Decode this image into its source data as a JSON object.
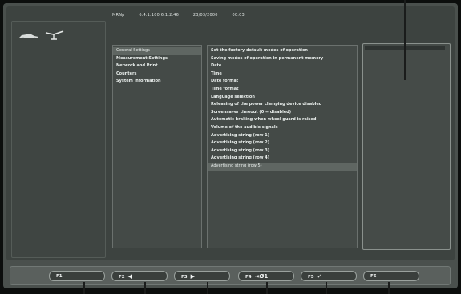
{
  "status": {
    "left": "MRNp",
    "versions": "6.4.1.100  6.1.2.46",
    "date": "23/03/2000",
    "time": "00:03"
  },
  "menu": {
    "items": [
      "General Settings",
      "Measurement Settings",
      "Network and Print",
      "Counters",
      "System information"
    ],
    "selected_index": 0
  },
  "options": {
    "items": [
      "Set the factory default modes of operation",
      "Saving modes of operation in permanent memory",
      "Date",
      "Time",
      "Date format",
      "Time format",
      "Language selection",
      "Releasing of the power clamping device disabled",
      "Screensaver timeout (0 = disabled)",
      "Automatic braking when wheel guard is raised",
      "Volume of the audible signals",
      "Advertising string (row 1)",
      "Advertising string (row 2)",
      "Advertising string (row 3)",
      "Advertising string (row 4)",
      "Advertising string (row 5)"
    ],
    "selected_index": 15
  },
  "function_keys": [
    {
      "label": "F1",
      "icon": ""
    },
    {
      "label": "F2",
      "icon": "◀"
    },
    {
      "label": "F3",
      "icon": "▶"
    },
    {
      "label": "F4",
      "icon": "⇥Ø1"
    },
    {
      "label": "F5",
      "icon": "✓"
    },
    {
      "label": "F6",
      "icon": ""
    }
  ],
  "icons": [
    "car-icon",
    "lift-icon"
  ],
  "colors": {
    "background": "#3d4340",
    "panel": "#444a47",
    "highlight": "#5f6662"
  }
}
